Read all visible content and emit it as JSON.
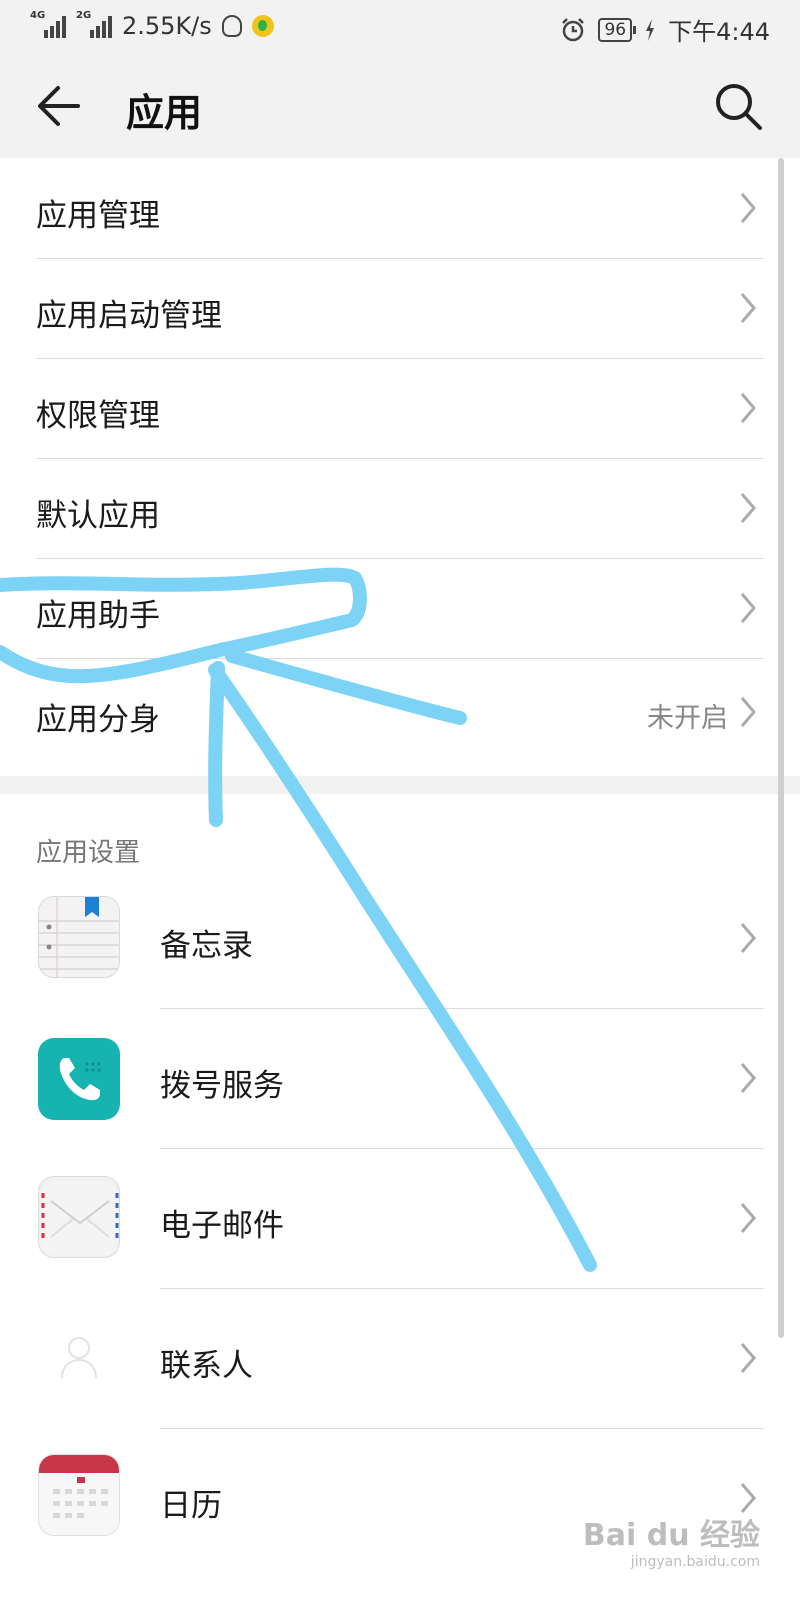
{
  "status_bar": {
    "signal1": "4G",
    "signal2": "2G",
    "speed": "2.55K/s",
    "battery": "96",
    "time": "下午4:44"
  },
  "app_bar": {
    "title": "应用"
  },
  "menu": {
    "items": [
      {
        "label": "应用管理",
        "value": ""
      },
      {
        "label": "应用启动管理",
        "value": ""
      },
      {
        "label": "权限管理",
        "value": ""
      },
      {
        "label": "默认应用",
        "value": ""
      },
      {
        "label": "应用助手",
        "value": ""
      },
      {
        "label": "应用分身",
        "value": "未开启"
      }
    ]
  },
  "app_settings": {
    "header": "应用设置",
    "apps": [
      {
        "label": "备忘录",
        "icon": "memo-icon"
      },
      {
        "label": "拨号服务",
        "icon": "phone-icon"
      },
      {
        "label": "电子邮件",
        "icon": "email-icon"
      },
      {
        "label": "联系人",
        "icon": "contacts-icon"
      },
      {
        "label": "日历",
        "icon": "calendar-icon"
      }
    ]
  },
  "watermark": {
    "brand": "Bai du 经验",
    "url": "jingyan.baidu.com"
  },
  "colors": {
    "annotation": "#7dd3f5",
    "dial_teal": "#17b3b0",
    "calendar_red": "#c8364a"
  }
}
